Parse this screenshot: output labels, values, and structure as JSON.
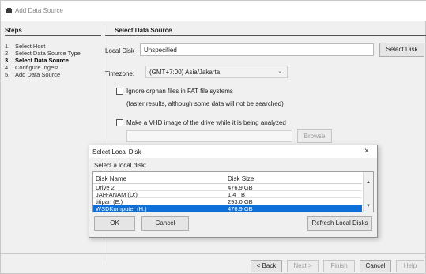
{
  "window": {
    "title": "Add Data Source"
  },
  "steps": {
    "heading": "Steps",
    "items": [
      {
        "num": "1.",
        "label": "Select Host"
      },
      {
        "num": "2.",
        "label": "Select Data Source Type"
      },
      {
        "num": "3.",
        "label": "Select Data Source"
      },
      {
        "num": "4.",
        "label": "Configure Ingest"
      },
      {
        "num": "5.",
        "label": "Add Data Source"
      }
    ]
  },
  "panel": {
    "heading": "Select Data Source",
    "local_disk_label": "Local Disk",
    "local_disk_value": "Unspecified",
    "select_disk_button": "Select Disk",
    "timezone_label": "Timezone:",
    "timezone_value": "(GMT+7:00) Asia/Jakarta",
    "ignore_orphan_label": "Ignore orphan files in FAT file systems",
    "ignore_orphan_note": "(faster results, although some data will not be searched)",
    "vhd_label": "Make a VHD image of the drive while it is being analyzed",
    "vhd_path_value": "",
    "browse_button": "Browse"
  },
  "dialog": {
    "title": "Select Local Disk",
    "close_glyph": "×",
    "subtitle": "Select a local disk:",
    "columns": [
      "Disk Name",
      "Disk Size"
    ],
    "rows": [
      {
        "name": "Drive 2",
        "size": "476.9 GB"
      },
      {
        "name": "JAH-ANAM (D:)",
        "size": "1.4 TB"
      },
      {
        "name": "titipan (E:)",
        "size": "293.0 GB"
      },
      {
        "name": "WSDKomputer (H:)",
        "size": "476.9 GB"
      }
    ],
    "ok_button": "OK",
    "cancel_button": "Cancel",
    "refresh_button": "Refresh Local Disks"
  },
  "footer": {
    "back_button": "< Back",
    "next_button": "Next >",
    "finish_button": "Finish",
    "cancel_button": "Cancel",
    "help_button": "Help"
  }
}
